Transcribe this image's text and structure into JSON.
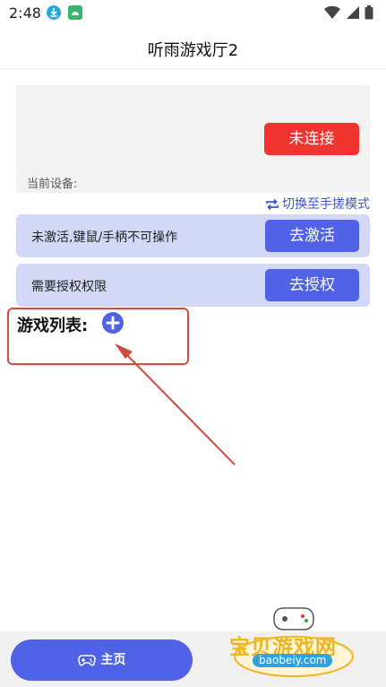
{
  "status": {
    "time": "2:48",
    "icons": [
      "download-icon",
      "android-icon",
      "wifi-icon",
      "signal-icon",
      "battery-icon"
    ]
  },
  "header": {
    "title": "听雨游戏厅2"
  },
  "device": {
    "connect_label": "未连接",
    "current_device_label": "当前设备:"
  },
  "switch_mode": {
    "label": "切换至手搓模式"
  },
  "activation": {
    "text": "未激活,键鼠/手柄不可操作",
    "button": "去激活"
  },
  "authorization": {
    "text": "需要授权权限",
    "button": "去授权"
  },
  "games": {
    "title": "游戏列表:"
  },
  "nav": {
    "home_label": "主页"
  },
  "watermark": {
    "brand": "宝贝游戏网",
    "url": "baobeiy.com"
  },
  "colors": {
    "primary": "#5063e6",
    "danger": "#f0342f",
    "card_bg": "#d3d8f6",
    "annotation": "#d24a3b"
  }
}
